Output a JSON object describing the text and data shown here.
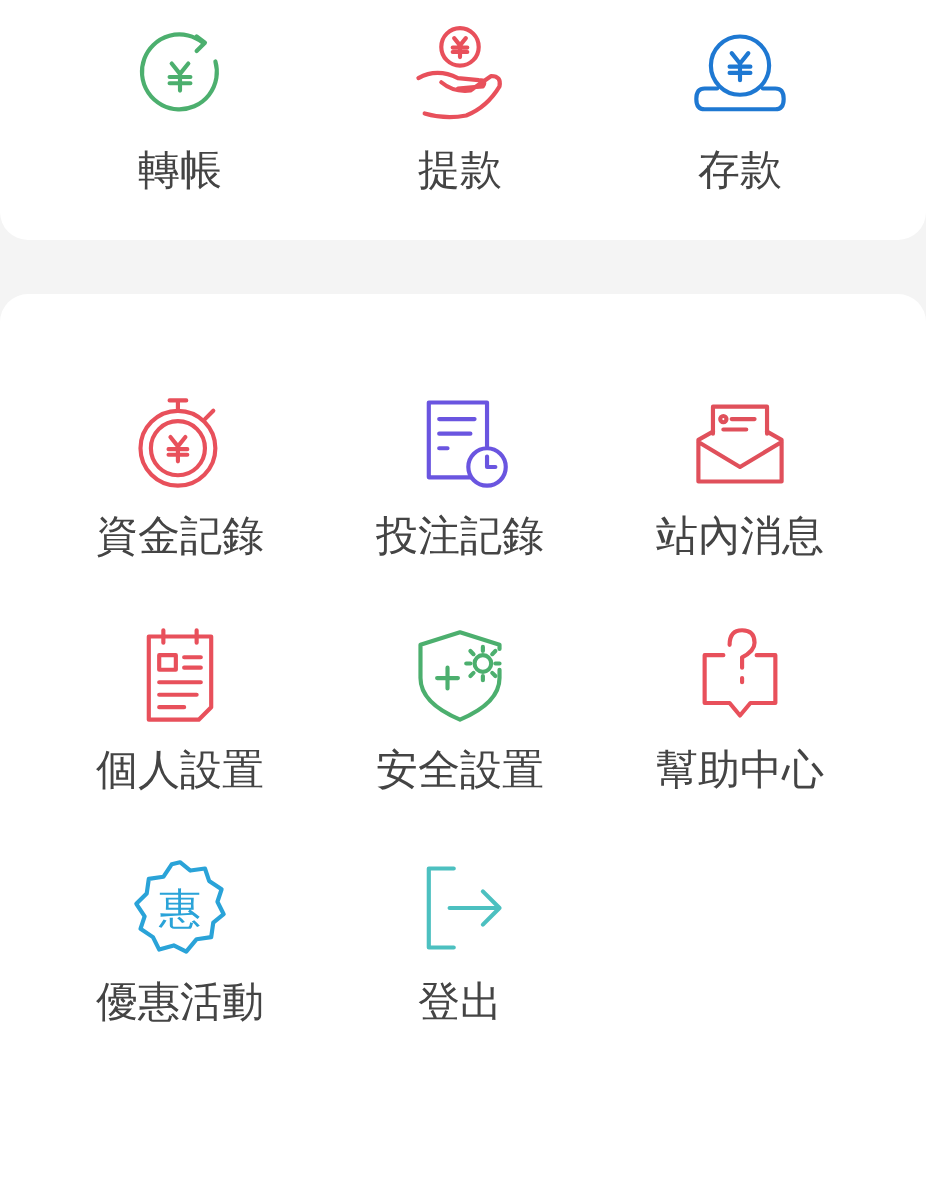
{
  "sections": [
    {
      "items": [
        {
          "label": "轉帳",
          "kind": "transfer",
          "color": "#4caf6e"
        },
        {
          "label": "提款",
          "kind": "withdraw",
          "color": "#e8505b"
        },
        {
          "label": "存款",
          "kind": "deposit",
          "color": "#1e78d2"
        }
      ]
    },
    {
      "items": [
        {
          "label": "資金記錄",
          "kind": "funds",
          "color": "#e8505b"
        },
        {
          "label": "投注記錄",
          "kind": "bets",
          "color": "#6a55e0"
        },
        {
          "label": "站內消息",
          "kind": "mail",
          "color": "#e0505b"
        },
        {
          "label": "個人設置",
          "kind": "profile",
          "color": "#e8505b"
        },
        {
          "label": "安全設置",
          "kind": "security",
          "color": "#4caf6e"
        },
        {
          "label": "幫助中心",
          "kind": "help",
          "color": "#e8505b"
        },
        {
          "label": "優惠活動",
          "kind": "promo",
          "color": "#2aa3d8",
          "glyph": "惠"
        },
        {
          "label": "登出",
          "kind": "logout",
          "color": "#4cc0c0"
        }
      ]
    }
  ]
}
